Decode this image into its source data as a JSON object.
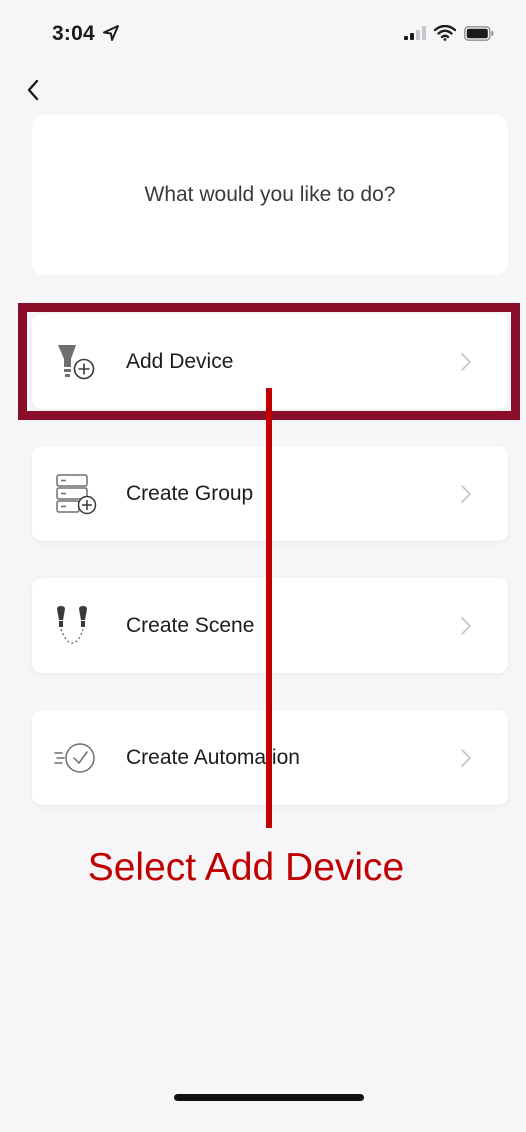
{
  "status_bar": {
    "time": "3:04"
  },
  "header": {
    "back_icon": "chevron-left-icon"
  },
  "prompt": {
    "title": "What would you like to do?"
  },
  "options": [
    {
      "label": "Add Device",
      "icon": "bulb-plus-icon"
    },
    {
      "label": "Create Group",
      "icon": "group-plus-icon"
    },
    {
      "label": "Create Scene",
      "icon": "scene-bulbs-icon"
    },
    {
      "label": "Create Automation",
      "icon": "clock-automation-icon"
    }
  ],
  "annotation": {
    "text": "Select Add Device",
    "color": "#c00000",
    "highlight_color": "#8a0e2a"
  }
}
